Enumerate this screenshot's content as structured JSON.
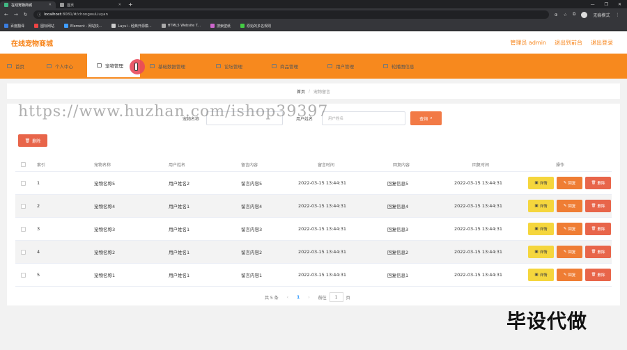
{
  "browser": {
    "tabs": [
      {
        "label": "在线宠物商城",
        "active": true
      },
      {
        "label": "首页",
        "active": false
      }
    ],
    "url_host": "localhost",
    "url_rest": ":8081/#/chongwuLiuyan",
    "profile": "无痕模式",
    "bookmarks": [
      "百度翻译",
      "图标网站",
      "Element - 网站快...",
      "Layui - 经典开源模...",
      "HTML5 Website T...",
      "搜索壁纸",
      "原始的多名规则"
    ]
  },
  "header": {
    "title": "在线宠物商城",
    "links": [
      "管理员 admin",
      "退出到前台",
      "退出登录"
    ]
  },
  "nav": {
    "items": [
      "首页",
      "个人中心",
      "宠物管理",
      "基础数据管理",
      "论坛管理",
      "商品管理",
      "用户管理",
      "轮播图信息"
    ],
    "active_index": 2
  },
  "breadcrumb": {
    "home": "首页",
    "sep": "/",
    "current": "宠物留言"
  },
  "watermark": "https://www.huzhan.com/ishop39397",
  "search": {
    "label1": "宠物名称",
    "label2": "用户姓名",
    "placeholder2": "用户姓名",
    "button": "查询"
  },
  "delete_button": "删除",
  "table": {
    "headers": [
      "索引",
      "宠物名称",
      "用户姓名",
      "留言内容",
      "留言时间",
      "回复内容",
      "回复时间",
      "操作"
    ],
    "rows": [
      {
        "idx": "1",
        "name": "宠物名称5",
        "user": "用户姓名2",
        "msg": "留言内容5",
        "mtime": "2022-03-15 13:44:31",
        "reply": "回复信息5",
        "rtime": "2022-03-15 13:44:31"
      },
      {
        "idx": "2",
        "name": "宠物名称4",
        "user": "用户姓名1",
        "msg": "留言内容4",
        "mtime": "2022-03-15 13:44:31",
        "reply": "回复信息4",
        "rtime": "2022-03-15 13:44:31"
      },
      {
        "idx": "3",
        "name": "宠物名称3",
        "user": "用户姓名1",
        "msg": "留言内容3",
        "mtime": "2022-03-15 13:44:31",
        "reply": "回复信息3",
        "rtime": "2022-03-15 13:44:31"
      },
      {
        "idx": "4",
        "name": "宠物名称2",
        "user": "用户姓名1",
        "msg": "留言内容2",
        "mtime": "2022-03-15 13:44:31",
        "reply": "回复信息2",
        "rtime": "2022-03-15 13:44:31"
      },
      {
        "idx": "5",
        "name": "宠物名称1",
        "user": "用户姓名1",
        "msg": "留言内容1",
        "mtime": "2022-03-15 13:44:31",
        "reply": "回复信息1",
        "rtime": "2022-03-15 13:44:31"
      }
    ],
    "ops": {
      "detail": "详情",
      "reply": "回复",
      "delete": "删除"
    }
  },
  "pager": {
    "total": "共 5 条",
    "current": "1",
    "goto": "前往",
    "page_input": "1",
    "page_suffix": "页"
  },
  "promo": "毕设代做",
  "colors": {
    "brand": "#f7891e",
    "detail": "#f5d63d",
    "reply": "#ef7d34",
    "delete": "#e8654a"
  }
}
